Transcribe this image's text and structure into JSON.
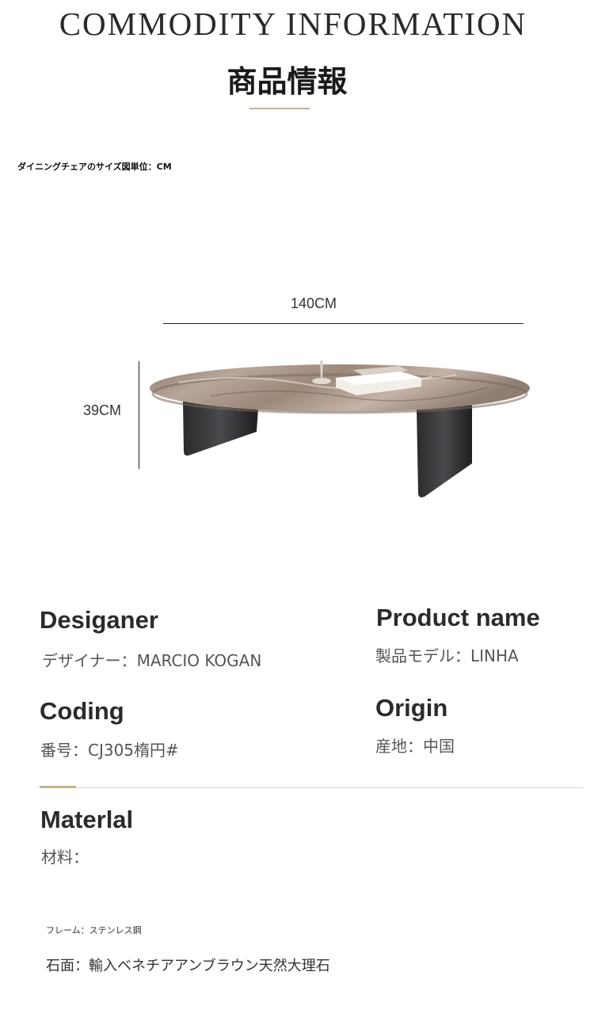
{
  "header": {
    "title_en": "COMMODITY INFORMATION",
    "title_jp": "商品情報"
  },
  "size_diagram": {
    "caption": "ダイニングチェアのサイズ図単位：CM",
    "width_label": "140CM",
    "height_label": "39CM"
  },
  "specs": {
    "designer": {
      "heading": "Desiganer",
      "value": "デザイナー：MARCIO KOGAN"
    },
    "product": {
      "heading": "Product name",
      "value": "製品モデル：LINHA"
    },
    "coding": {
      "heading": "Coding",
      "value": "番号：CJ305楕円#"
    },
    "origin": {
      "heading": "Origin",
      "value": "産地：中国"
    }
  },
  "material": {
    "heading": "Materlal",
    "value": "材料：",
    "frame": "フレーム：ステンレス鋼",
    "top": "石面：輸入ベネチアアンブラウン天然大理石"
  },
  "colors": {
    "accent": "#c9b08a",
    "text": "#333333"
  }
}
